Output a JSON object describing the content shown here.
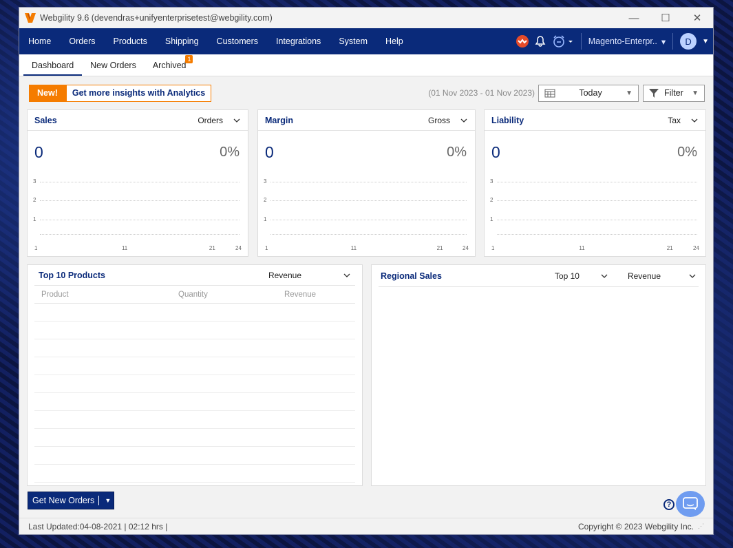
{
  "window": {
    "title": "Webgility 9.6 (devendras+unifyenterprisetest@webgility.com)"
  },
  "menu": {
    "items": [
      "Home",
      "Orders",
      "Products",
      "Shipping",
      "Customers",
      "Integrations",
      "System",
      "Help"
    ],
    "store": "Magento-Enterpr..",
    "avatar": "D"
  },
  "tabs": {
    "dashboard": "Dashboard",
    "new_orders": "New Orders",
    "archived": "Archived",
    "archived_badge": "1"
  },
  "toolbar": {
    "new": "New!",
    "insights": "Get more insights with Analytics",
    "date_range": "(01 Nov 2023 - 01 Nov 2023)",
    "period": "Today",
    "filter": "Filter"
  },
  "cards": {
    "sales": {
      "title": "Sales",
      "select": "Orders",
      "value": "0",
      "pct": "0%"
    },
    "margin": {
      "title": "Margin",
      "select": "Gross",
      "value": "0",
      "pct": "0%"
    },
    "liability": {
      "title": "Liability",
      "select": "Tax",
      "value": "0",
      "pct": "0%"
    }
  },
  "chart_data": [
    {
      "type": "line",
      "x": [
        1,
        11,
        21,
        24
      ],
      "y_ticks": [
        1,
        2,
        3
      ],
      "series": []
    },
    {
      "type": "line",
      "x": [
        1,
        11,
        21,
        24
      ],
      "y_ticks": [
        1,
        2,
        3
      ],
      "series": []
    },
    {
      "type": "line",
      "x": [
        1,
        11,
        21,
        24
      ],
      "y_ticks": [
        1,
        2,
        3
      ],
      "series": []
    }
  ],
  "top_products": {
    "title": "Top 10 Products",
    "select": "Revenue",
    "columns": [
      "Product",
      "Quantity",
      "Revenue"
    ]
  },
  "regional": {
    "title": "Regional Sales",
    "top": "Top 10",
    "select": "Revenue"
  },
  "actions": {
    "get_orders": "Get New Orders"
  },
  "status": {
    "last_updated": "Last Updated:04-08-2021 | 02:12 hrs |",
    "copyright": "Copyright © 2023 Webgility Inc."
  },
  "colors": {
    "brand": "#0a2a7a",
    "accent": "#f57c00"
  }
}
